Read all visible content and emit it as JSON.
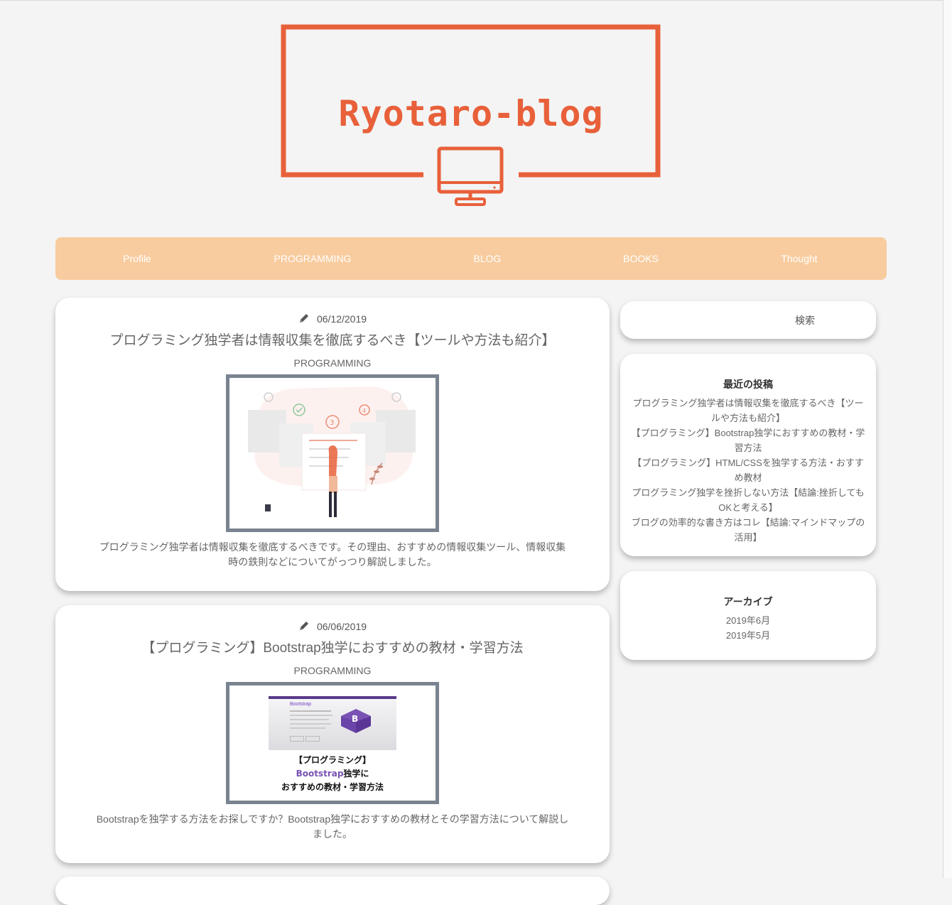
{
  "site": {
    "logo_text": "Ryotaro-blog",
    "accent_color": "#e8603a",
    "nav_color": "#f8cc9f"
  },
  "nav": {
    "items": [
      {
        "label": "Profile"
      },
      {
        "label": "PROGRAMMING"
      },
      {
        "label": "BLOG"
      },
      {
        "label": "BOOKS"
      },
      {
        "label": "Thought"
      }
    ]
  },
  "posts": [
    {
      "date": "06/12/2019",
      "title": "プログラミング独学者は情報収集を徹底するべき【ツールや方法も紹介】",
      "category": "PROGRAMMING",
      "excerpt": "プログラミング独学者は情報収集を徹底するべきです。その理由、おすすめの情報収集ツール、情報収集時の鉄則などについてがっつり解説しました。",
      "thumbnail_icon": "checklist-illustration"
    },
    {
      "date": "06/06/2019",
      "title": "【プログラミング】Bootstrap独学におすすめの教材・学習方法",
      "category": "PROGRAMMING",
      "excerpt": "Bootstrapを独学する方法をお探しですか？Bootstrap独学におすすめの教材とその学習方法について解説しました。",
      "thumbnail": {
        "line1": "【プログラミング】",
        "line2_highlight": "Bootstrap",
        "line2_rest": "独学に",
        "line3": "おすすめの教材・学習方法",
        "screenshot_heading": "Bootstrap",
        "badge_letter": "B"
      }
    }
  ],
  "sidebar": {
    "search_label": "検索",
    "recent": {
      "title": "最近の投稿",
      "items": [
        "プログラミング独学者は情報収集を徹底するべき【ツールや方法も紹介】",
        "【プログラミング】Bootstrap独学におすすめの教材・学習方法",
        "【プログラミング】HTML/CSSを独学する方法・おすすめ教材",
        "プログラミング独学を挫折しない方法【結論:挫折してもOKと考える】",
        "ブログの効率的な書き方はコレ【結論:マインドマップの活用】"
      ]
    },
    "archive": {
      "title": "アーカイブ",
      "items": [
        "2019年6月",
        "2019年5月"
      ]
    }
  }
}
